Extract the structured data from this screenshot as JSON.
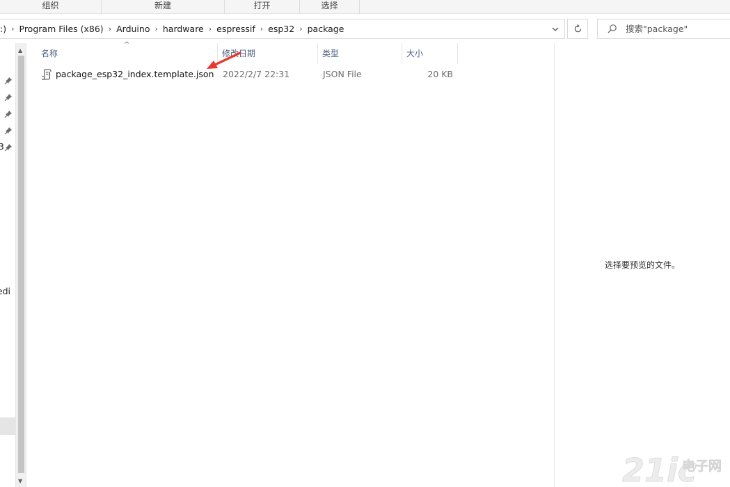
{
  "ribbon": {
    "groups": [
      "组织",
      "新建",
      "打开",
      "选择"
    ]
  },
  "address": {
    "partial_root": ":)",
    "crumbs": [
      "Program Files (x86)",
      "Arduino",
      "hardware",
      "espressif",
      "esp32",
      "package"
    ]
  },
  "search": {
    "placeholder": "搜索\"package\""
  },
  "nav": {
    "partial_labels": [
      "3",
      "nedi"
    ]
  },
  "columns": {
    "name": "名称",
    "date": "修改日期",
    "type": "类型",
    "size": "大小"
  },
  "files": [
    {
      "name": "package_esp32_index.template.json",
      "date": "2022/2/7 22:31",
      "type": "JSON File",
      "size": "20 KB"
    }
  ],
  "preview": {
    "message": "选择要预览的文件。"
  },
  "watermark": {
    "text": "21ic电子网"
  },
  "colors": {
    "annotation_arrow": "#e8372c",
    "column_header": "#4d6082",
    "watermark": "#e9e9e9"
  }
}
